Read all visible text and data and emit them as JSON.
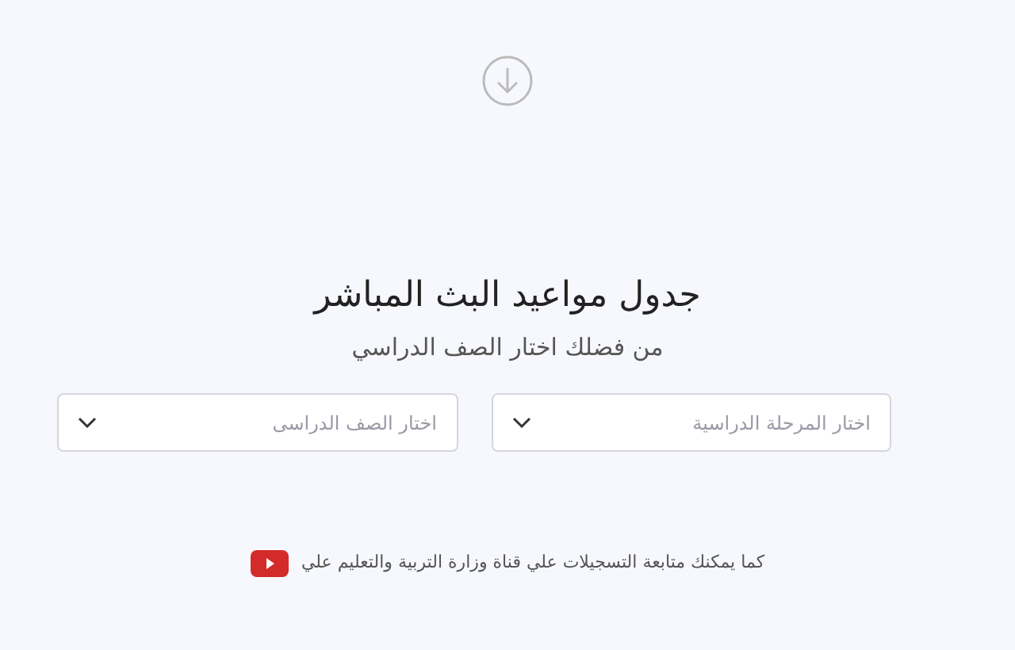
{
  "title": "جدول مواعيد البث المباشر",
  "subtitle": "من فضلك اختار الصف الدراسي",
  "selects": [
    {
      "placeholder": "اختار المرحلة الدراسية"
    },
    {
      "placeholder": "اختار الصف الدراسى"
    }
  ],
  "footer": "كما يمكنك متابعة التسجيلات علي قناة وزارة التربية والتعليم علي"
}
